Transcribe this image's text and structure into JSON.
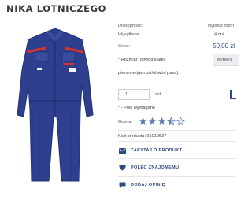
{
  "product": {
    "title": "NIKA LOTNICZEGO",
    "availability_label": "Dostępność:",
    "availability_value": "wybierz rozm",
    "shipping_label": "Wysyłka w:",
    "shipping_value": "4 dni",
    "price_label": "Cena:",
    "price_value": "50,00 zł",
    "size_label_line1": "* Rozmiar (obwód klatki",
    "size_label_line2": "piersiowej/wzrost/obwód pasa):",
    "size_select_value": "wybierz",
    "quantity_value": "1",
    "quantity_unit": "szt.",
    "required_note": "* - Pole wymagane",
    "rating_label": "Ocena:",
    "rating_value": 3.5,
    "rating_max": 5,
    "product_code_label": "Kod produktu:",
    "product_code_value": "91010537"
  },
  "actions": {
    "ask": "ZAPYTAJ O PRODUKT",
    "recommend": "POLEĆ ZNAJOMEMU",
    "review": "DODAJ OPINIĘ"
  },
  "colors": {
    "accent": "#2d4a83",
    "star": "#5b7db5",
    "suit": "#2e3f8f",
    "stripe_red": "#d9302b"
  },
  "icons": {
    "ask": "envelope-icon",
    "recommend": "heart-icon",
    "review": "chat-bubble-icon",
    "cart": "cart-icon"
  }
}
